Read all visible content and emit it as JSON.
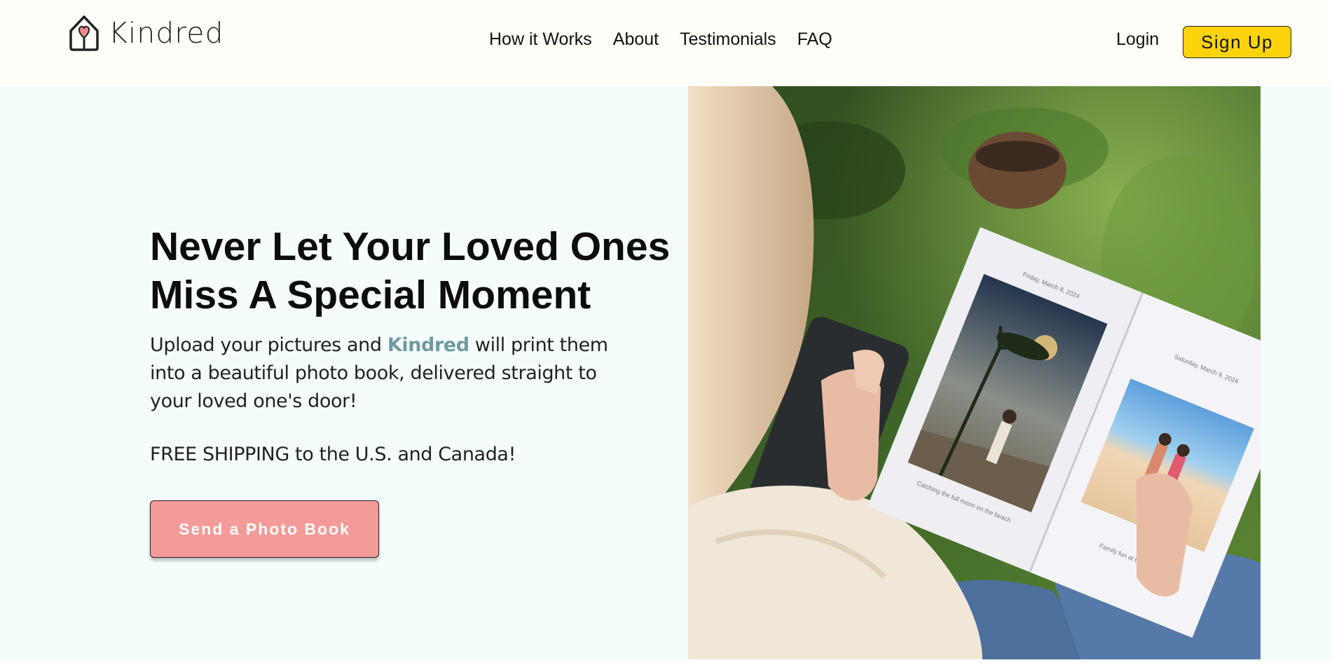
{
  "header": {
    "brand": "Kindred",
    "nav": [
      "How it Works",
      "About",
      "Testimonials",
      "FAQ"
    ],
    "login": "Login",
    "signup": "Sign Up"
  },
  "hero": {
    "title": "Never Let Your Loved Ones Miss A Special Moment",
    "subtitle_before": "Upload your pictures and ",
    "subtitle_brand": "Kindred",
    "subtitle_after": " will print them into a beautiful photo book, delivered straight to your loved one's door!",
    "shipping": "FREE SHIPPING to the U.S. and Canada!",
    "cta": "Send a Photo Book"
  },
  "photo_book": {
    "left_date": "Friday, March 8, 2024",
    "left_caption": "Catching the full moon on the beach",
    "right_date": "Saturday, March 9, 2024",
    "right_caption": "Family fun at the beach"
  },
  "icons": {
    "logo": "house-heart-icon"
  },
  "colors": {
    "header_bg": "#fffef8",
    "hero_bg": "#f5fdfc",
    "signup_bg": "#fdd30c",
    "cta_bg": "#f49a98",
    "brand_accent": "#6f9aa0"
  }
}
